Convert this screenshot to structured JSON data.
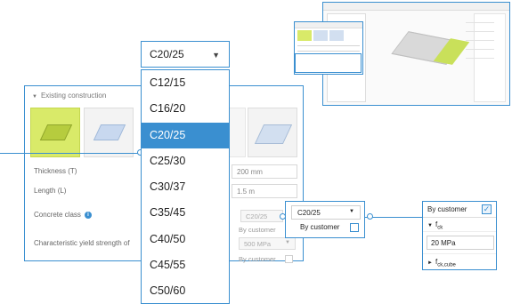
{
  "dropdown": {
    "selected": "C20/25",
    "options": [
      "C12/15",
      "C16/20",
      "C20/25",
      "C25/30",
      "C30/37",
      "C35/45",
      "C40/50",
      "C45/55",
      "C50/60"
    ]
  },
  "panel": {
    "header": "Existing construction",
    "thickness_label": "Thickness (T)",
    "thickness_value": "200 mm",
    "length_label": "Length (L)",
    "length_value": "1.5 m",
    "concrete_label": "Concrete class",
    "concrete_value": "C20/25",
    "yield_label": "Characteristic yield strength of",
    "by_customer_1": "By customer",
    "yield_value": "500 MPa",
    "by_customer_2": "By customer"
  },
  "mini_widget": {
    "selected": "C20/25",
    "by_customer": "By customer"
  },
  "fck_widget": {
    "by_customer": "By customer",
    "checked": true,
    "fck_label": "f",
    "fck_sub": "ck",
    "fck_value": "20 MPa",
    "fck_cube_label": "f",
    "fck_cube_sub": "ck,cube"
  },
  "colors": {
    "accent": "#3a8fd0",
    "selected_material": "#d9ea69"
  }
}
